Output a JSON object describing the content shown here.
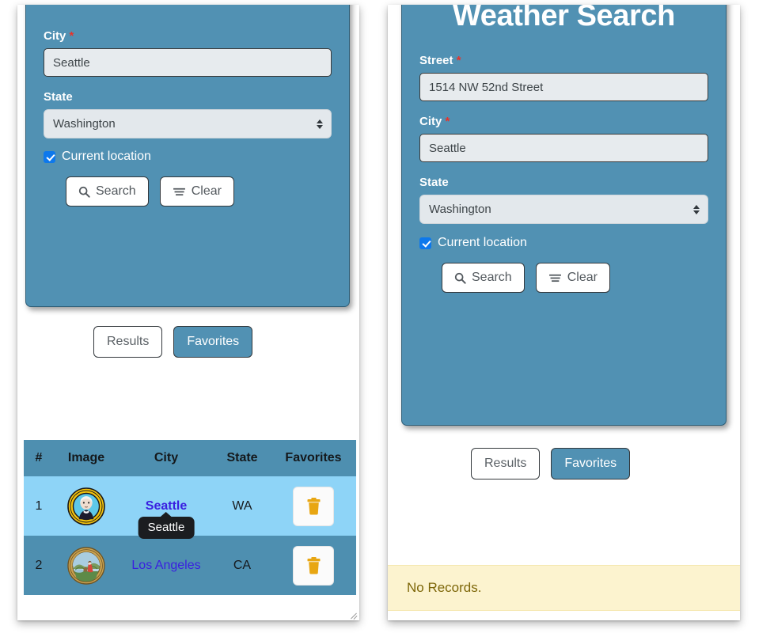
{
  "app": {
    "title": "Weather Search"
  },
  "form": {
    "street": {
      "label": "Street",
      "required_mark": "*",
      "value": "1514 NW 52nd Street",
      "placeholder": "Street"
    },
    "city": {
      "label": "City",
      "required_mark": "*",
      "value": "Seattle",
      "placeholder": "City"
    },
    "state": {
      "label": "State",
      "value": "Washington",
      "options": [
        "Washington"
      ]
    },
    "current_location": {
      "label": "Current location",
      "checked": true
    },
    "buttons": {
      "search_label": "Search",
      "search_icon": "search-icon",
      "clear_label": "Clear",
      "clear_icon": "clear-lines-icon"
    }
  },
  "tabs": {
    "results_label": "Results",
    "favorites_label": "Favorites",
    "active": "Favorites"
  },
  "table": {
    "headers": [
      "#",
      "Image",
      "City",
      "State",
      "Favorites"
    ],
    "rows": [
      {
        "num": "1",
        "image_alt": "washington-state-seal",
        "city": "Seattle",
        "state": "WA",
        "action_icon": "trash-icon",
        "highlighted": true,
        "tooltip": "Seattle"
      },
      {
        "num": "2",
        "image_alt": "california-state-seal",
        "city": "Los Angeles",
        "state": "CA",
        "action_icon": "trash-icon",
        "highlighted": false,
        "tooltip": ""
      }
    ]
  },
  "alert": {
    "no_records": "No Records."
  },
  "colors": {
    "panel_teal": "#5191b3",
    "table_header": "#4e8fb0",
    "row_highlight": "#8ed4f7",
    "required_red": "#e8332a",
    "link_purple": "#3a1fe0",
    "trash_gold": "#e8a612",
    "alert_bg": "#fcf3cf",
    "alert_text": "#7d6608",
    "checkbox_blue": "#0d78ec"
  }
}
